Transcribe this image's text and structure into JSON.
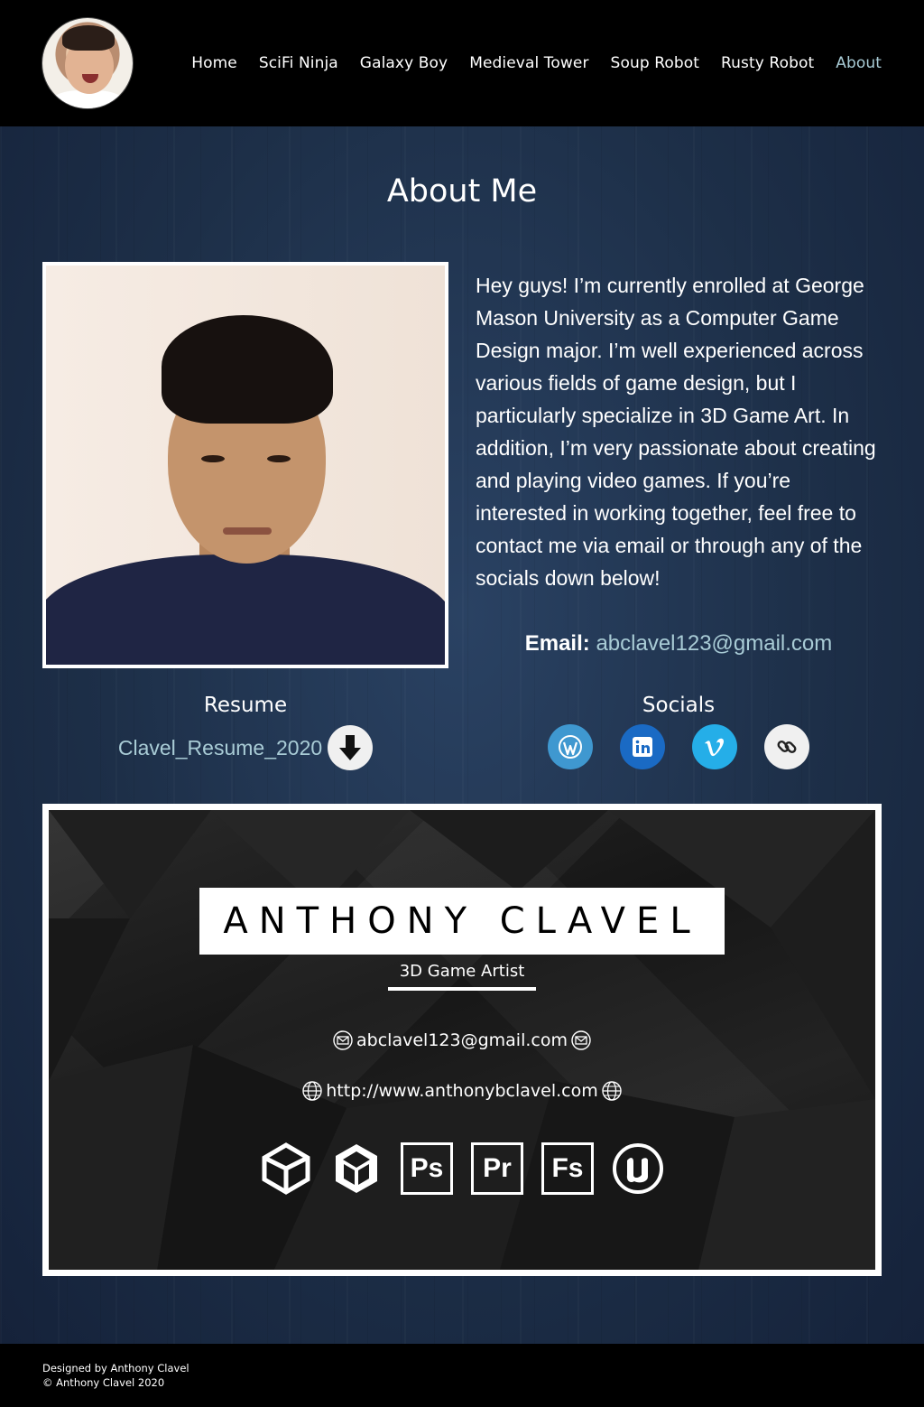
{
  "header": {
    "nav": [
      {
        "label": "Home"
      },
      {
        "label": "SciFi Ninja"
      },
      {
        "label": "Galaxy Boy"
      },
      {
        "label": "Medieval Tower"
      },
      {
        "label": "Soup Robot"
      },
      {
        "label": "Rusty Robot"
      },
      {
        "label": "About"
      }
    ],
    "active_nav": "About"
  },
  "main": {
    "title": "About Me",
    "bio": "Hey guys! I’m currently enrolled at George Mason University as a Computer Game Design major. I’m well experienced across various fields of game design, but I particularly specialize in 3D Game Art. In addition, I’m very passionate about creating and playing video games. If you’re interested in working together, feel free to contact me via email or through any of the socials down below!",
    "email_label": "Email:",
    "email": "abclavel123@gmail.com",
    "resume_title": "Resume",
    "resume_link": "Clavel_Resume_2020",
    "socials_title": "Socials",
    "socials": [
      {
        "icon": "wordpress-icon",
        "color": "#3f98d0"
      },
      {
        "icon": "linkedin-icon",
        "color": "#1a6ac4"
      },
      {
        "icon": "vimeo-icon",
        "color": "#25aee8"
      },
      {
        "icon": "link-icon",
        "color": "#f0f0f0"
      }
    ]
  },
  "card": {
    "name": "ANTHONY CLAVEL",
    "role": "3D Game Artist",
    "email": "abclavel123@gmail.com",
    "website": "http://www.anthonybclavel.com",
    "tools": [
      {
        "icon": "unity-icon"
      },
      {
        "icon": "3ds-max-icon"
      },
      {
        "icon": "photoshop-icon",
        "label": "Ps"
      },
      {
        "icon": "premiere-icon",
        "label": "Pr"
      },
      {
        "icon": "fuse-icon",
        "label": "Fs"
      },
      {
        "icon": "unreal-engine-icon"
      }
    ]
  },
  "footer": {
    "designed_by": "Designed by Anthony Clavel",
    "copyright": "© Anthony Clavel 2020"
  },
  "colors": {
    "accent": "#a9ccd6",
    "header_bg": "#000000",
    "page_bg": "#1d2f48"
  }
}
